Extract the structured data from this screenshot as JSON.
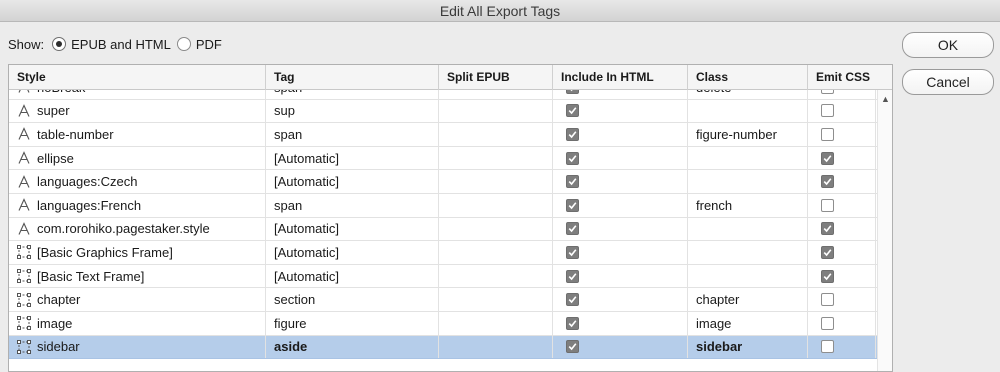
{
  "window": {
    "title": "Edit All Export Tags"
  },
  "show": {
    "label": "Show:",
    "options": [
      {
        "label": "EPUB and HTML",
        "selected": true
      },
      {
        "label": "PDF",
        "selected": false
      }
    ]
  },
  "buttons": {
    "ok": "OK",
    "cancel": "Cancel"
  },
  "table": {
    "columns": {
      "style": "Style",
      "tag": "Tag",
      "split": "Split EPUB",
      "html": "Include In HTML",
      "class": "Class",
      "css": "Emit CSS"
    },
    "rows": [
      {
        "icon": "character-style-icon",
        "style": "noBreak",
        "tag": "span",
        "split": "",
        "include_html": true,
        "class": "delete",
        "emit_css": false,
        "selected": false
      },
      {
        "icon": "character-style-icon",
        "style": "super",
        "tag": "sup",
        "split": "",
        "include_html": true,
        "class": "",
        "emit_css": false,
        "selected": false
      },
      {
        "icon": "character-style-icon",
        "style": "table-number",
        "tag": "span",
        "split": "",
        "include_html": true,
        "class": "figure-number",
        "emit_css": false,
        "selected": false
      },
      {
        "icon": "character-style-icon",
        "style": "ellipse",
        "tag": "[Automatic]",
        "split": "",
        "include_html": true,
        "class": "",
        "emit_css": true,
        "selected": false
      },
      {
        "icon": "character-style-icon",
        "style": "languages:Czech",
        "tag": "[Automatic]",
        "split": "",
        "include_html": true,
        "class": "",
        "emit_css": true,
        "selected": false
      },
      {
        "icon": "character-style-icon",
        "style": "languages:French",
        "tag": "span",
        "split": "",
        "include_html": true,
        "class": "french",
        "emit_css": false,
        "selected": false
      },
      {
        "icon": "character-style-icon",
        "style": "com.rorohiko.pagestaker.style",
        "tag": "[Automatic]",
        "split": "",
        "include_html": true,
        "class": "",
        "emit_css": true,
        "selected": false
      },
      {
        "icon": "object-style-icon",
        "style": "[Basic Graphics Frame]",
        "tag": "[Automatic]",
        "split": "",
        "include_html": true,
        "class": "",
        "emit_css": true,
        "selected": false
      },
      {
        "icon": "object-style-icon",
        "style": "[Basic Text Frame]",
        "tag": "[Automatic]",
        "split": "",
        "include_html": true,
        "class": "",
        "emit_css": true,
        "selected": false
      },
      {
        "icon": "object-style-icon",
        "style": "chapter",
        "tag": "section",
        "split": "",
        "include_html": true,
        "class": "chapter",
        "emit_css": false,
        "selected": false
      },
      {
        "icon": "object-style-icon",
        "style": "image",
        "tag": "figure",
        "split": "",
        "include_html": true,
        "class": "image",
        "emit_css": false,
        "selected": false
      },
      {
        "icon": "object-style-icon",
        "style": "sidebar",
        "tag": "aside",
        "split": "",
        "include_html": true,
        "class": "sidebar",
        "emit_css": false,
        "selected": true
      }
    ]
  },
  "colors": {
    "selection": "#b5cdea",
    "checkbox_checked": "#7e7e7e"
  }
}
